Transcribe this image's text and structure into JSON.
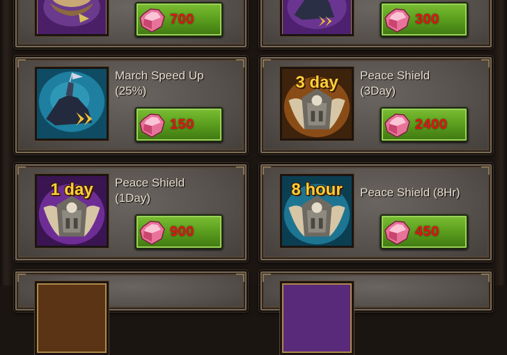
{
  "shop_items": [
    {
      "name": "",
      "price": "700",
      "icon": "horn-icon",
      "icon_label": ""
    },
    {
      "name": "",
      "price": "300",
      "icon": "knight-speed-icon",
      "icon_label": ""
    },
    {
      "name": "March Speed Up\n(25%)",
      "price": "150",
      "icon": "knight-speed-icon",
      "icon_label": ""
    },
    {
      "name": "Peace Shield\n(3Day)",
      "price": "2400",
      "icon": "peace-shield-icon",
      "icon_label": "3 day"
    },
    {
      "name": "Peace Shield\n(1Day)",
      "price": "900",
      "icon": "peace-shield-icon",
      "icon_label": "1 day"
    },
    {
      "name": "Peace Shield (8Hr)",
      "price": "450",
      "icon": "peace-shield-icon",
      "icon_label": "8 hour"
    }
  ],
  "colors": {
    "price": "#e01616",
    "button": "#5da11f",
    "icon_label": "#ffd03a",
    "bg_purple": "#5a2a7a",
    "bg_blue": "#1d6f8c",
    "bg_brown": "#5a3414"
  }
}
